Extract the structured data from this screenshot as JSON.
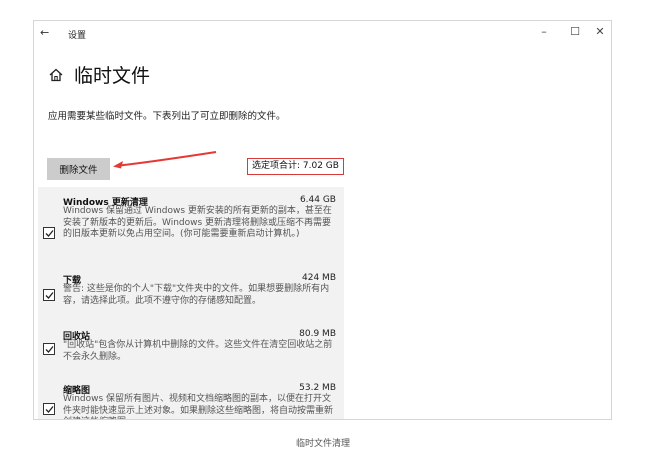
{
  "window": {
    "back_label": "←",
    "title": "设置",
    "minimize_label": "–",
    "maximize_label": "☐",
    "close_label": "✕"
  },
  "page": {
    "title": "临时文件",
    "description": "应用需要某些临时文件。下表列出了可立即删除的文件。",
    "delete_button": "删除文件",
    "selected_total": "选定项合计: 7.02 GB"
  },
  "items": [
    {
      "name": "Windows 更新清理",
      "size": "6.44 GB",
      "desc": "Windows 保留通过 Windows 更新安装的所有更新的副本，甚至在安装了新版本的更新后。Windows 更新清理将删除或压缩不再需要的旧版本更新以免占用空间。(你可能需要重新启动计算机。)",
      "checked": true
    },
    {
      "name": "下载",
      "size": "424 MB",
      "desc": "警告: 这些是你的个人\"下载\"文件夹中的文件。如果想要删除所有内容，请选择此项。此项不遵守你的存储感知配置。",
      "checked": true
    },
    {
      "name": "回收站",
      "size": "80.9 MB",
      "desc": "\"回收站\"包含你从计算机中删除的文件。这些文件在清空回收站之前不会永久删除。",
      "checked": true
    },
    {
      "name": "缩略图",
      "size": "53.2 MB",
      "desc": "Windows 保留所有图片、视频和文档缩略图的副本，以便在打开文件夹时能快速显示上述对象。如果删除这些缩略图，将自动按需重新创建这些缩略图。",
      "checked": true
    }
  ],
  "caption": "临时文件清理",
  "colors": {
    "highlight_red": "#d83a3a",
    "button_gray": "#cccccc",
    "list_bg": "#f2f2f2"
  },
  "icons": {
    "page_icon": "home-icon",
    "checkbox": "checkmark-icon",
    "annotation": "arrow-icon"
  }
}
